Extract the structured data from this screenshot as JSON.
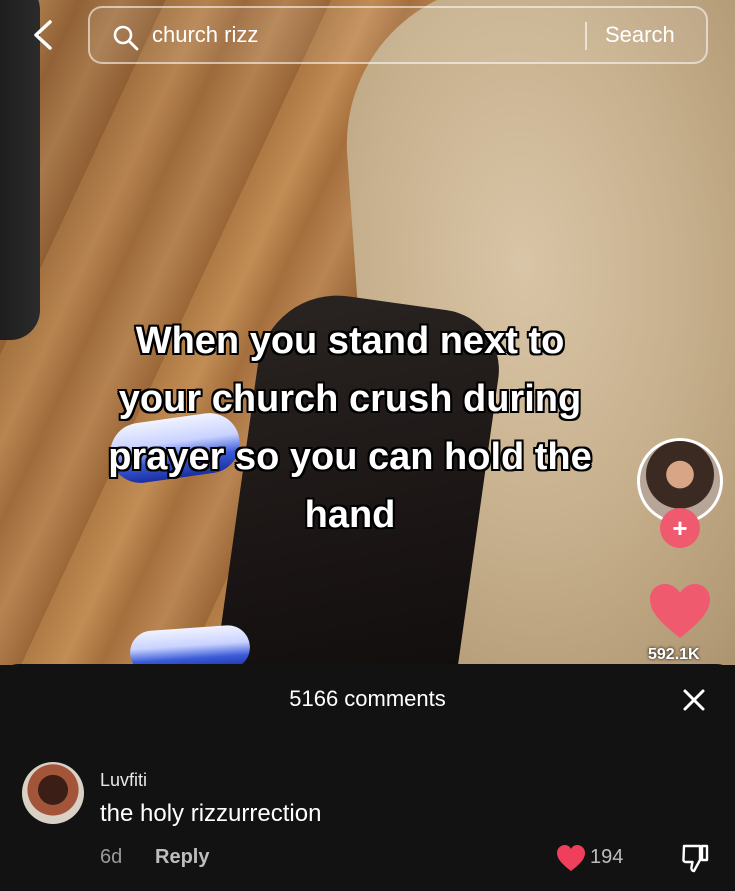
{
  "search": {
    "query": "church rizz",
    "button_label": "Search"
  },
  "video": {
    "caption_lines": [
      "When you stand next to",
      "your church crush during",
      "prayer so you can hold the",
      "hand"
    ],
    "like_count": "592.1K",
    "follow_symbol": "+"
  },
  "comments": {
    "title": "5166 comments",
    "items": [
      {
        "username": "Luvfiti",
        "text": "the holy rizzurrection",
        "age": "6d",
        "reply_label": "Reply",
        "likes": "194"
      }
    ]
  },
  "colors": {
    "accent_like": "#ef5a6f",
    "sheet_bg": "#121212"
  },
  "icons": [
    "back-arrow-icon",
    "search-icon",
    "heart-icon",
    "close-icon",
    "dislike-icon"
  ]
}
